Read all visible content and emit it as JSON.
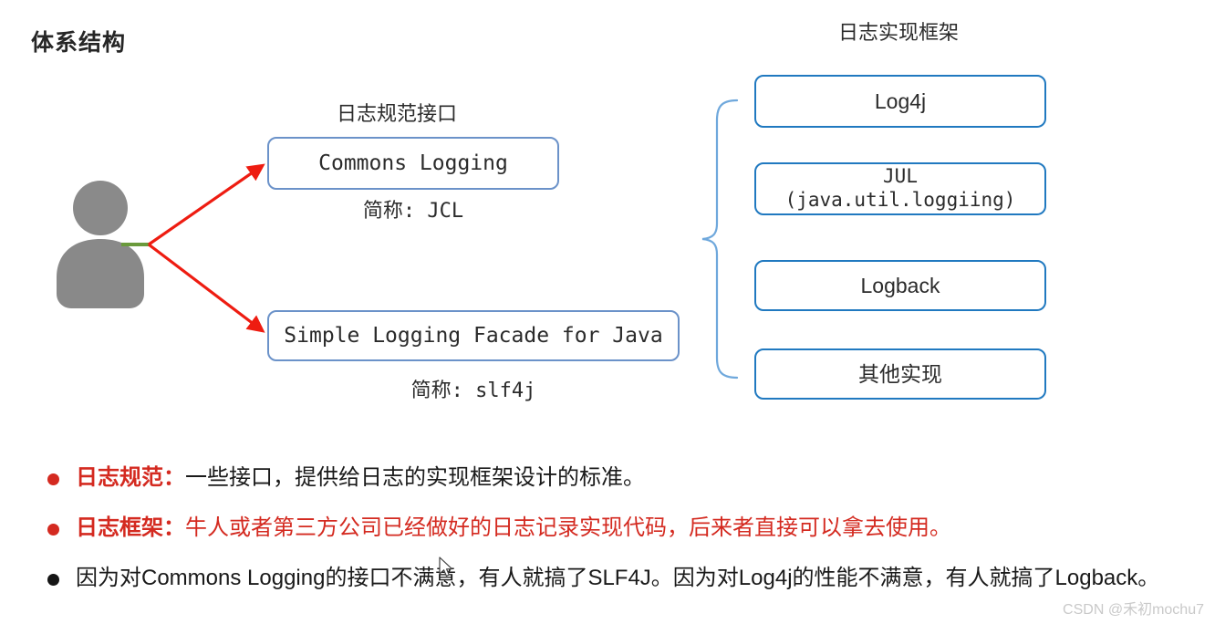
{
  "slide": {
    "title": "体系结构"
  },
  "captions": {
    "left": "日志规范接口",
    "right": "日志实现框架"
  },
  "spec_boxes": [
    {
      "label": "Commons Logging",
      "sublabel": "简称: JCL"
    },
    {
      "label": "Simple Logging Facade for Java",
      "sublabel": "简称: slf4j"
    }
  ],
  "impl_boxes": [
    {
      "label": "Log4j"
    },
    {
      "label": "JUL\n(java.util.loggiing)"
    },
    {
      "label": "Logback"
    },
    {
      "label": "其他实现"
    }
  ],
  "bullets": [
    {
      "marker_color": "#d42a20",
      "head": "日志规范：",
      "body": "一些接口，提供给日志的实现框架设计的标准。",
      "body_color": "black"
    },
    {
      "marker_color": "#d42a20",
      "head": "日志框架：",
      "body": "牛人或者第三方公司已经做好的日志记录实现代码，后来者直接可以拿去使用。",
      "body_color": "red"
    },
    {
      "marker_color": "#151515",
      "head": "",
      "body": "因为对Commons Logging的接口不满意，有人就搞了SLF4J。因为对Log4j的性能不满意，有人就搞了Logback。",
      "body_color": "black"
    }
  ],
  "watermark": "CSDN @禾初mochu7",
  "colors": {
    "accent_red": "#d42a20",
    "box_border_left": "#6b92c9",
    "box_border_right": "#2079c0",
    "brace": "#6fa8dc",
    "person": "#808080",
    "arrow": "#ee1c11"
  },
  "icons": {
    "person": "person-icon",
    "brace": "curly-brace-icon",
    "cursor": "mouse-cursor-icon"
  }
}
